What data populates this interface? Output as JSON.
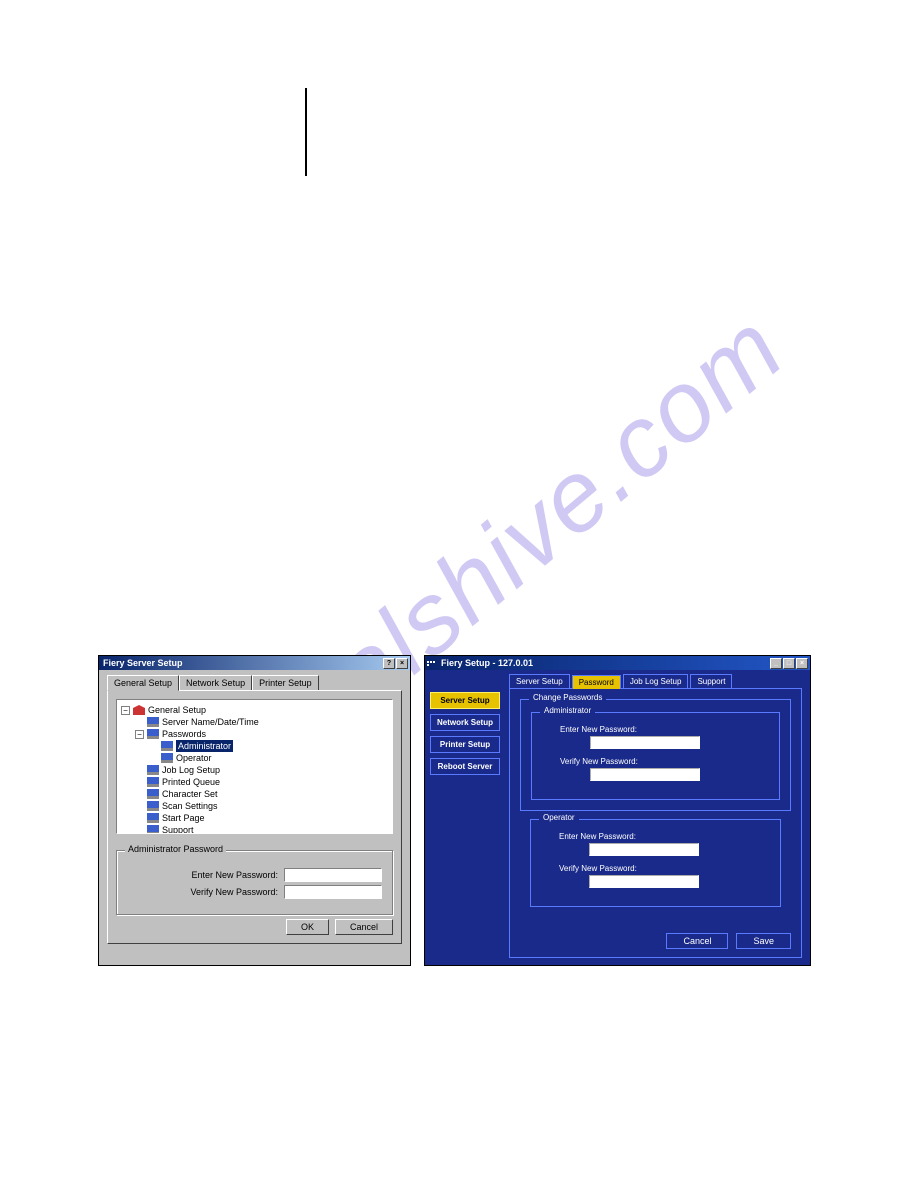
{
  "watermark": "manualshive.com",
  "left": {
    "title": "Fiery Server Setup",
    "tabs": [
      "General Setup",
      "Network Setup",
      "Printer Setup"
    ],
    "tree": {
      "root": "General Setup",
      "items": [
        "Server Name/Date/Time",
        "Passwords",
        "Administrator",
        "Operator",
        "Job Log Setup",
        "Printed Queue",
        "Character Set",
        "Scan Settings",
        "Start Page",
        "Support"
      ]
    },
    "group": {
      "title": "Administrator Password",
      "enter": "Enter New Password:",
      "verify": "Verify New Password:"
    },
    "ok": "OK",
    "cancel": "Cancel"
  },
  "right": {
    "title": "Fiery Setup - 127.0.01",
    "side": [
      "Server Setup",
      "Network Setup",
      "Printer Setup",
      "Reboot Server"
    ],
    "tabs": [
      "Server Setup",
      "Password",
      "Job Log Setup",
      "Support"
    ],
    "group_outer": "Change Passwords",
    "admin": {
      "title": "Administrator",
      "enter": "Enter New Password:",
      "verify": "Verify New Password:"
    },
    "operator": {
      "title": "Operator",
      "enter": "Enter New Password:",
      "verify": "Verify New Password:"
    },
    "cancel": "Cancel",
    "save": "Save"
  }
}
